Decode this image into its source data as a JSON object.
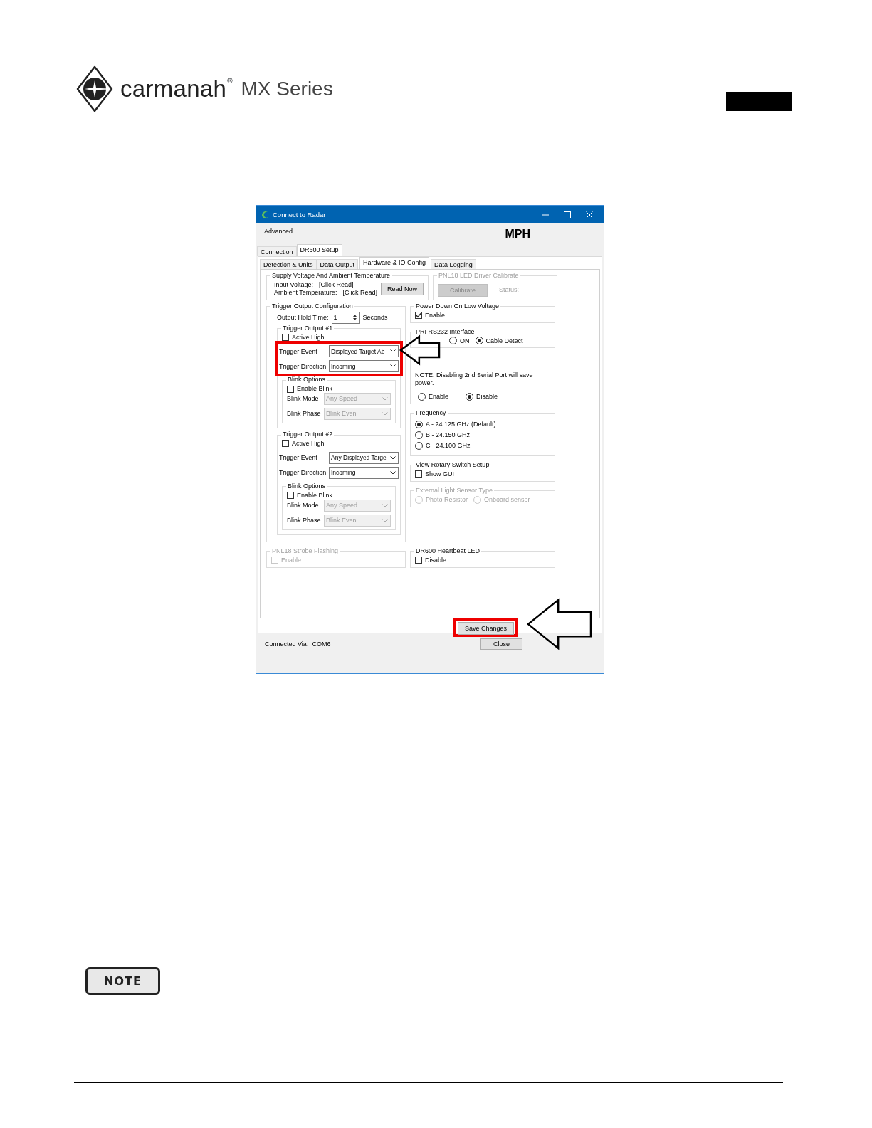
{
  "header": {
    "brand": "carmanah",
    "brand_mark": "®",
    "series": "MX Series"
  },
  "window": {
    "title": "Connect to Radar",
    "menu": [
      "Advanced"
    ],
    "unit": "MPH",
    "tabs": [
      {
        "label": "Connection",
        "selected": false
      },
      {
        "label": "DR600 Setup",
        "selected": true
      }
    ],
    "subtabs": [
      {
        "label": "Detection & Units",
        "selected": false
      },
      {
        "label": "Data Output",
        "selected": false
      },
      {
        "label": "Hardware & IO Config",
        "selected": true
      },
      {
        "label": "Data Logging",
        "selected": false
      }
    ],
    "supply": {
      "title": "Supply Voltage And Ambient Temperature",
      "rows": [
        {
          "label": "Input Voltage:",
          "value": "[Click Read]"
        },
        {
          "label": "Ambient Temperature:",
          "value": "[Click Read]"
        }
      ],
      "button": "Read Now"
    },
    "calibrate": {
      "title": "PNL18 LED Driver Calibrate",
      "disabled": true,
      "button": "Calibrate",
      "status_label": "Status:"
    },
    "trigger_config": {
      "title": "Trigger Output Configuration",
      "hold_label": "Output Hold Time:",
      "hold_value": "1",
      "hold_unit": "Seconds",
      "outputs": [
        {
          "title": "Trigger Output #1",
          "highlighted": true,
          "active_high": {
            "label": "Active High",
            "checked": false
          },
          "event": {
            "label": "Trigger Event",
            "value": "Displayed Target Ab"
          },
          "direction": {
            "label": "Trigger Direction",
            "value": "Incoming"
          },
          "blink": {
            "title": "Blink Options",
            "enable": {
              "label": "Enable Blink",
              "checked": false
            },
            "mode": {
              "label": "Blink Mode",
              "value": "Any Speed",
              "disabled": true
            },
            "phase": {
              "label": "Blink Phase",
              "value": "Blink Even",
              "disabled": true
            }
          }
        },
        {
          "title": "Trigger Output #2",
          "highlighted": false,
          "active_high": {
            "label": "Active High",
            "checked": false
          },
          "event": {
            "label": "Trigger Event",
            "value": "Any Displayed Targe"
          },
          "direction": {
            "label": "Trigger Direction",
            "value": "Incoming"
          },
          "blink": {
            "title": "Blink Options",
            "enable": {
              "label": "Enable Blink",
              "checked": false
            },
            "mode": {
              "label": "Blink Mode",
              "value": "Any Speed",
              "disabled": true
            },
            "phase": {
              "label": "Blink Phase",
              "value": "Blink Even",
              "disabled": true
            }
          }
        }
      ]
    },
    "power_down": {
      "title": "Power Down On Low Voltage",
      "checkbox": {
        "label": "Enable",
        "checked": true
      }
    },
    "pri_interface": {
      "title": "PRI RS232 Interface",
      "options": [
        {
          "label": "ON",
          "selected": false
        },
        {
          "label": "Cable Detect",
          "selected": true
        }
      ]
    },
    "serial_port": {
      "note": "NOTE: Disabling 2nd Serial Port will save power.",
      "options": [
        {
          "label": "Enable",
          "selected": false
        },
        {
          "label": "Disable",
          "selected": true
        }
      ]
    },
    "frequency": {
      "title": "Frequency",
      "options": [
        {
          "label": "A - 24.125 GHz (Default)",
          "selected": true
        },
        {
          "label": "B - 24.150 GHz",
          "selected": false
        },
        {
          "label": "C - 24.100 GHz",
          "selected": false
        }
      ]
    },
    "rotary": {
      "title": "View Rotary Switch Setup",
      "checkbox": {
        "label": "Show GUI",
        "checked": false
      }
    },
    "light_sensor": {
      "title": "External Light Sensor Type",
      "disabled": true,
      "options": [
        {
          "label": "Photo Resistor",
          "selected": false
        },
        {
          "label": "Onboard sensor",
          "selected": false
        }
      ]
    },
    "strobe": {
      "title": "PNL18 Strobe Flashing",
      "disabled": true,
      "checkbox": {
        "label": "Enable",
        "checked": false
      }
    },
    "heartbeat": {
      "title": "DR600 Heartbeat LED",
      "checkbox": {
        "label": "Disable",
        "checked": false
      }
    },
    "save_button": {
      "label": "Save Changes",
      "highlighted": true
    },
    "status": {
      "label": "Connected Via:",
      "value": "COM6"
    },
    "close_button": "Close"
  },
  "note_badge": "NOTE"
}
